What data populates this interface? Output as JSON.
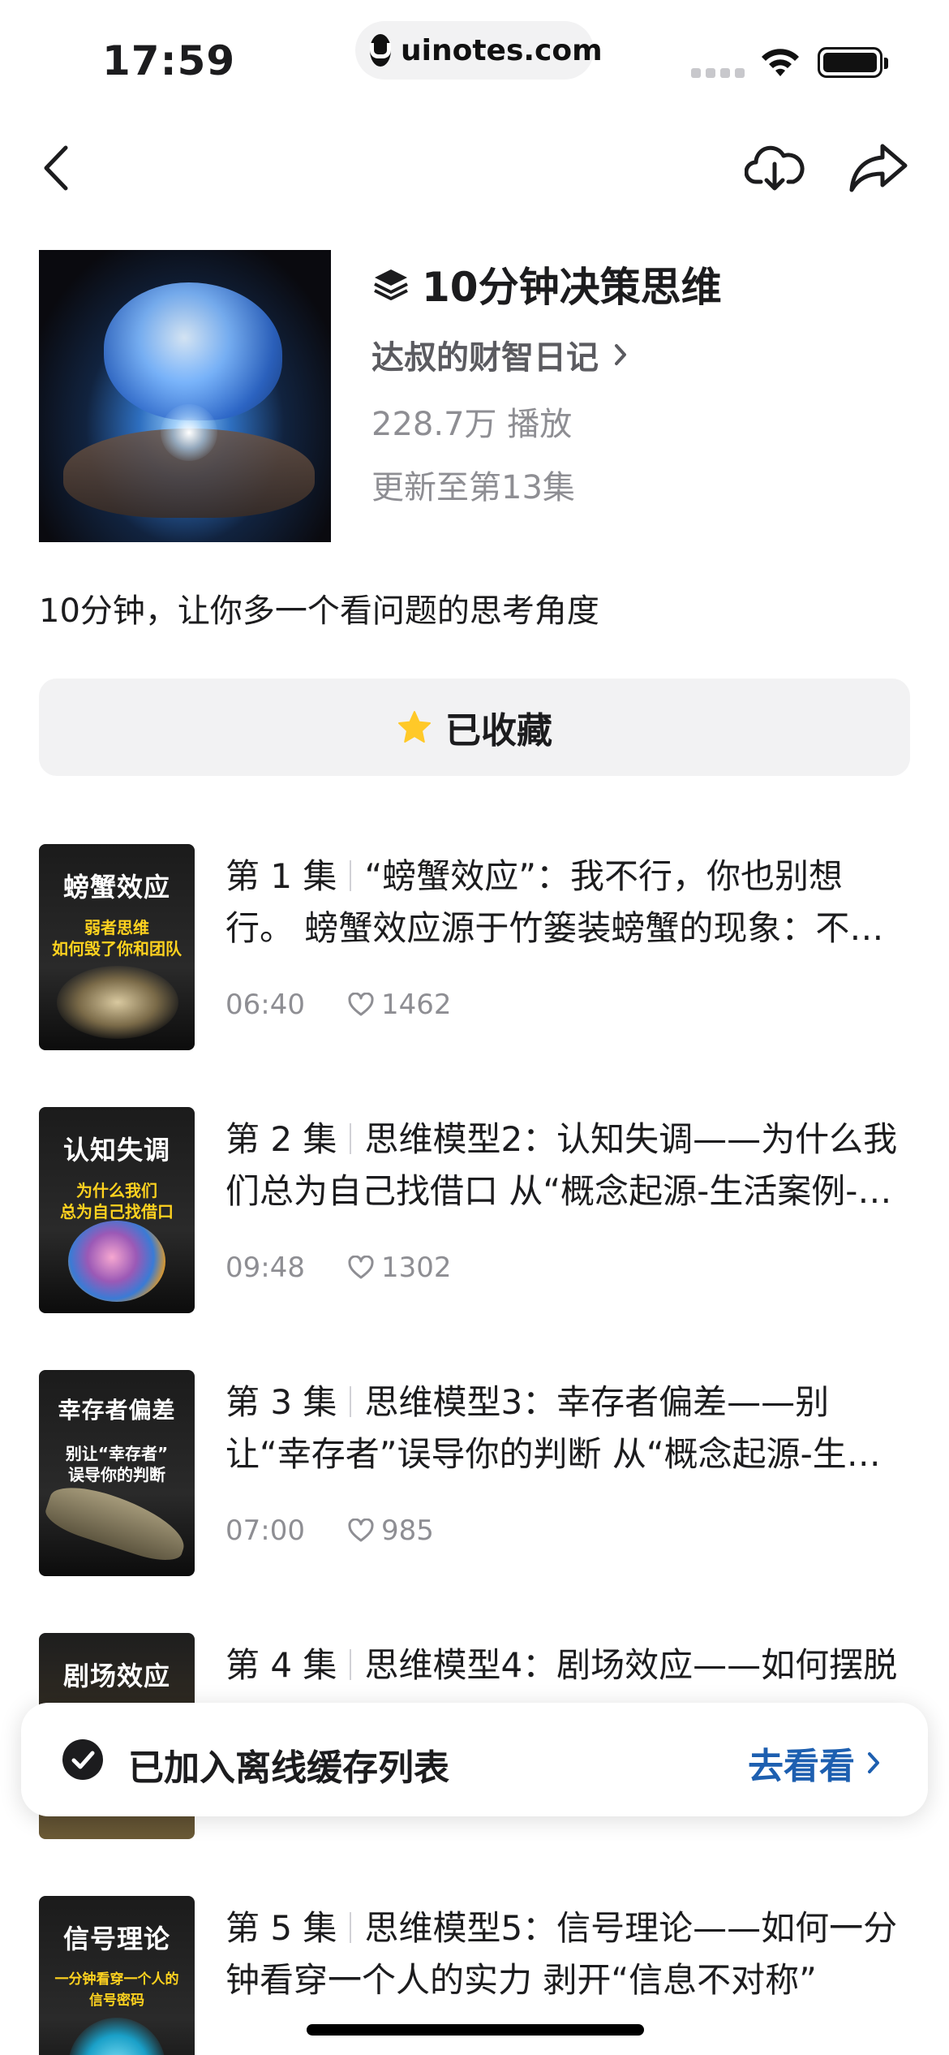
{
  "status_bar": {
    "time": "17:59",
    "url": "uinotes.com"
  },
  "nav": {
    "back_icon": "chevron-left-icon",
    "download_icon": "cloud-download-icon",
    "share_icon": "share-arrow-icon"
  },
  "album": {
    "title": "10分钟决策思维",
    "author": "达叔的财智日记",
    "plays": "228.7万 播放",
    "update": "更新至第13集",
    "description": "10分钟，让你多一个看问题的思考角度"
  },
  "collect_button": {
    "label": "已收藏",
    "icon": "star-icon",
    "star_color": "#ffc928"
  },
  "episodes": [
    {
      "number": "第 1 集",
      "text": "“螃蟹效应”：我不行，你也别想行。 螃蟹效应源于竹篓装螃蟹的现象：不会有螃蟹爬出来",
      "duration": "06:40",
      "likes": "1462",
      "thumb_title": "螃蟹效应",
      "thumb_sub": "弱者思维\n如何毁了你和团队"
    },
    {
      "number": "第 2 集",
      "text": "思维模型2：认知失调——为什么我们总为自己找借口 从“概念起源-生活案例-应对方法”",
      "duration": "09:48",
      "likes": "1302",
      "thumb_title": "认知失调",
      "thumb_sub": "为什么我们\n总为自己找借口"
    },
    {
      "number": "第 3 集",
      "text": "思维模型3：幸存者偏差——别让“幸存者”误导你的判断 从“概念起源-生活案例”",
      "duration": "07:00",
      "likes": "985",
      "thumb_title": "幸存者偏差",
      "thumb_sub": "别让“幸存者”\n误导你的判断"
    },
    {
      "number": "第 4 集",
      "text": "思维模型4：剧场效应——如何摆脱",
      "duration": "",
      "likes": "",
      "thumb_title": "剧场效应",
      "thumb_sub": ""
    },
    {
      "number": "第 5 集",
      "text": "思维模型5：信号理论——如何一分钟看穿一个人的实力 剥开“信息不对称”",
      "duration": "",
      "likes": "",
      "thumb_title": "信号理论",
      "thumb_sub": "一分钟看穿一个人的\n信号密码"
    }
  ],
  "toast": {
    "message": "已加入离线缓存列表",
    "action": "去看看",
    "action_color": "#1d5fb0"
  }
}
